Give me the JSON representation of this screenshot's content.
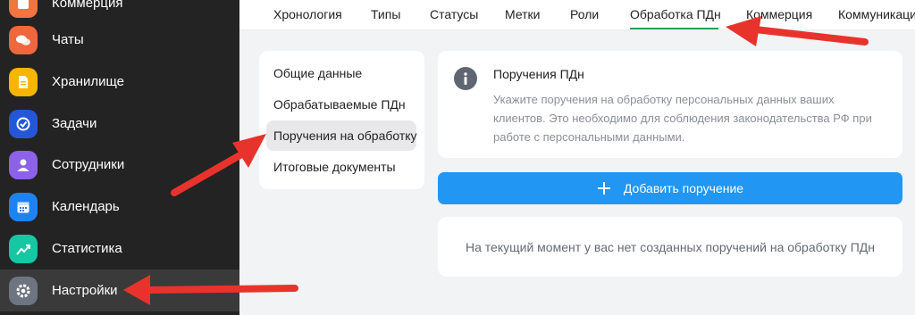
{
  "sidebar": {
    "items": [
      {
        "label": "Коммерция",
        "icon": "commerce-icon",
        "color": "#f1753f"
      },
      {
        "label": "Чаты",
        "icon": "chat-icon",
        "color": "#f0663e"
      },
      {
        "label": "Хранилище",
        "icon": "file-icon",
        "color": "#f7b500"
      },
      {
        "label": "Задачи",
        "icon": "task-check-icon",
        "color": "#2556d8"
      },
      {
        "label": "Сотрудники",
        "icon": "user-icon",
        "color": "#8c62e8"
      },
      {
        "label": "Календарь",
        "icon": "calendar-icon",
        "color": "#1f82f3"
      },
      {
        "label": "Статистика",
        "icon": "stats-icon",
        "color": "#15c7a2"
      },
      {
        "label": "Настройки",
        "icon": "gear-icon",
        "color": "#6e7580"
      }
    ],
    "active_item": "Настройки"
  },
  "tabs": {
    "items": [
      "Хронология",
      "Типы",
      "Статусы",
      "Метки",
      "Роли",
      "Обработка ПДн",
      "Коммерция",
      "Коммуникаци"
    ],
    "active": "Обработка ПДн",
    "accent": "#1ba257"
  },
  "settings_menu": {
    "items": [
      "Общие данные",
      "Обрабатываемые ПДн",
      "Поручения на обработку",
      "Итоговые документы"
    ],
    "active": "Поручения на обработку"
  },
  "info": {
    "title": "Поручения ПДн",
    "text": "Укажите поручения на обработку персональных данных ваших клиентов. Это необходимо для соблюдения законодательства РФ при работе с персональными данными."
  },
  "add_button": {
    "label": "Добавить поручение",
    "color": "#2196f3"
  },
  "empty_state": {
    "text": "На текущий момент у вас нет созданных поручений на обработку ПДн"
  },
  "annotation_color": "#e8332c"
}
